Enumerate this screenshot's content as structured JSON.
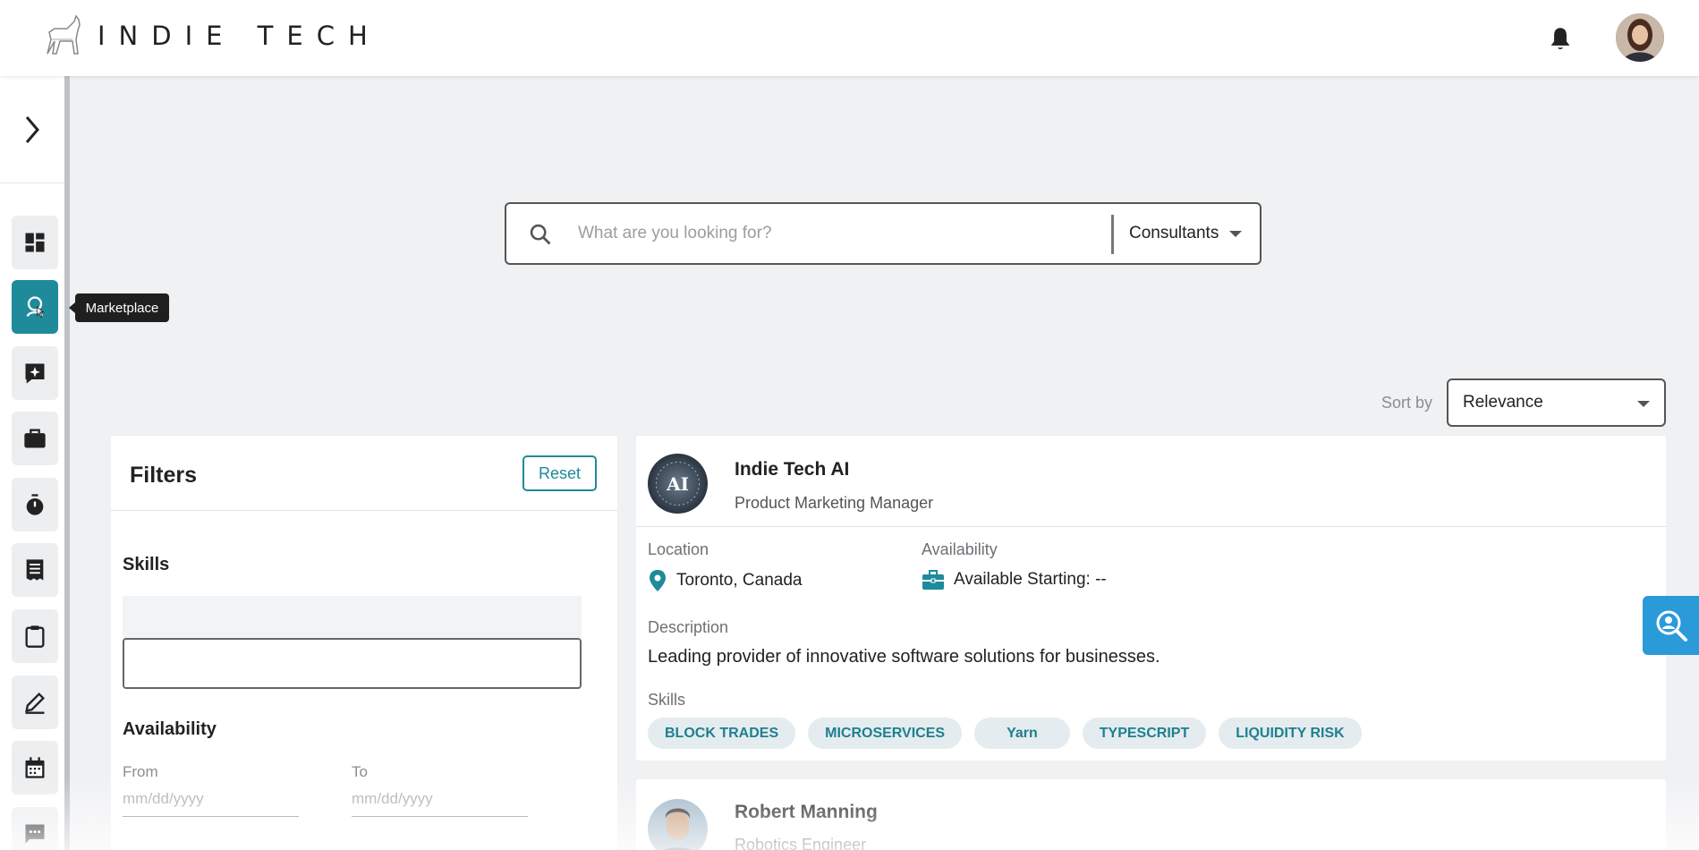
{
  "app": {
    "logo_text": "INDIE TECH"
  },
  "header": {
    "notification_icon": "bell-icon",
    "avatar_icon": "user-avatar"
  },
  "sidebar": {
    "toggle_icon": "chevron-right-icon",
    "items": [
      {
        "icon": "dashboard-icon",
        "active": false
      },
      {
        "icon": "marketplace-icon",
        "active": true
      },
      {
        "icon": "sparkle-chat-icon",
        "active": false
      },
      {
        "icon": "briefcase-icon",
        "active": false
      },
      {
        "icon": "stopwatch-icon",
        "active": false
      },
      {
        "icon": "receipt-icon",
        "active": false
      },
      {
        "icon": "clipboard-icon",
        "active": false
      },
      {
        "icon": "edit-icon",
        "active": false
      },
      {
        "icon": "calendar-icon",
        "active": false
      },
      {
        "icon": "message-icon",
        "active": false
      }
    ],
    "tooltip": "Marketplace"
  },
  "search": {
    "placeholder": "What are you looking for?",
    "value": "",
    "category": "Consultants"
  },
  "sort": {
    "label": "Sort by",
    "value": "Relevance"
  },
  "filters": {
    "title": "Filters",
    "reset_label": "Reset",
    "skills_label": "Skills",
    "availability_label": "Availability",
    "from_label": "From",
    "to_label": "To",
    "from_placeholder": "mm/dd/yyyy",
    "to_placeholder": "mm/dd/yyyy"
  },
  "results": [
    {
      "name": "Indie Tech AI",
      "role": "Product Marketing Manager",
      "location_label": "Location",
      "location": "Toronto, Canada",
      "availability_label": "Availability",
      "availability": "Available Starting: --",
      "description_label": "Description",
      "description": "Leading provider of innovative software solutions for businesses.",
      "skills_label": "Skills",
      "skills": [
        "BLOCK TRADES",
        "MICROSERVICES",
        "Yarn",
        "TYPESCRIPT",
        "LIQUIDITY RISK"
      ],
      "avatar_text": "AI"
    },
    {
      "name": "Robert Manning",
      "role": "Robotics Engineer"
    }
  ],
  "colors": {
    "accent": "#1e8a9a",
    "float_button": "#2a9ad8"
  },
  "float_button_icon": "search-person-icon"
}
